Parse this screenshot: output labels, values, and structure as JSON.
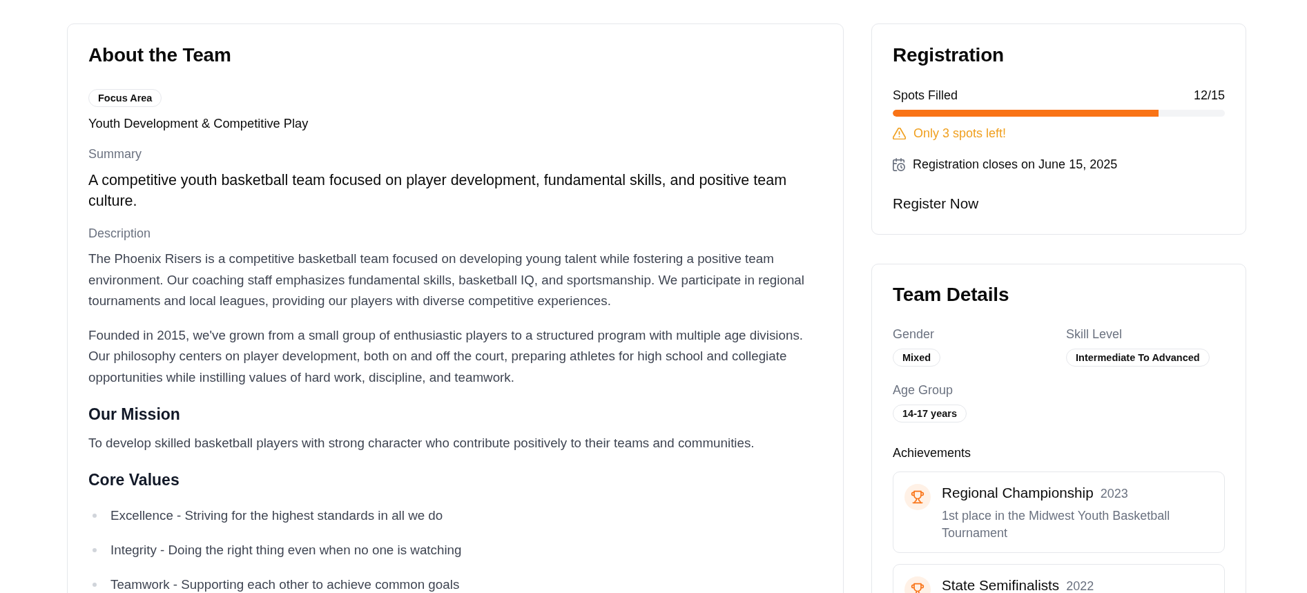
{
  "about": {
    "title": "About the Team",
    "focus_area": {
      "badge": "Focus Area",
      "value": "Youth Development & Competitive Play"
    },
    "summary": {
      "label": "Summary",
      "text": "A competitive youth basketball team focused on player development, fundamental skills, and positive team culture."
    },
    "description": {
      "label": "Description",
      "paragraphs": [
        "The Phoenix Risers is a competitive basketball team focused on developing young talent while fostering a positive team environment. Our coaching staff emphasizes fundamental skills, basketball IQ, and sportsmanship. We participate in regional tournaments and local leagues, providing our players with diverse competitive experiences.",
        "Founded in 2015, we've grown from a small group of enthusiastic players to a structured program with multiple age divisions. Our philosophy centers on player development, both on and off the court, preparing athletes for high school and collegiate opportunities while instilling values of hard work, discipline, and teamwork."
      ]
    },
    "mission": {
      "heading": "Our Mission",
      "text": "To develop skilled basketball players with strong character who contribute positively to their teams and communities."
    },
    "core_values": {
      "heading": "Core Values",
      "items": [
        "Excellence - Striving for the highest standards in all we do",
        "Integrity - Doing the right thing even when no one is watching",
        "Teamwork - Supporting each other to achieve common goals"
      ]
    }
  },
  "registration": {
    "title": "Registration",
    "spots": {
      "label": "Spots Filled",
      "count": "12/15",
      "level": 0.8
    },
    "warning": "Only 3 spots left!",
    "deadline": "Registration closes on June 15, 2025",
    "button": "Register Now"
  },
  "team_details": {
    "title": "Team Details",
    "fields": [
      {
        "label": "Gender",
        "value": "Mixed"
      },
      {
        "label": "Skill Level",
        "value": "Intermediate To Advanced"
      },
      {
        "label": "Age Group",
        "value": "14-17 years"
      }
    ],
    "achievements": {
      "heading": "Achievements",
      "items": [
        {
          "title": "Regional Championship",
          "year": "2023",
          "description": "1st place in the Midwest Youth Basketball Tournament"
        },
        {
          "title": "State Semifinalists",
          "year": "2022"
        }
      ]
    }
  }
}
